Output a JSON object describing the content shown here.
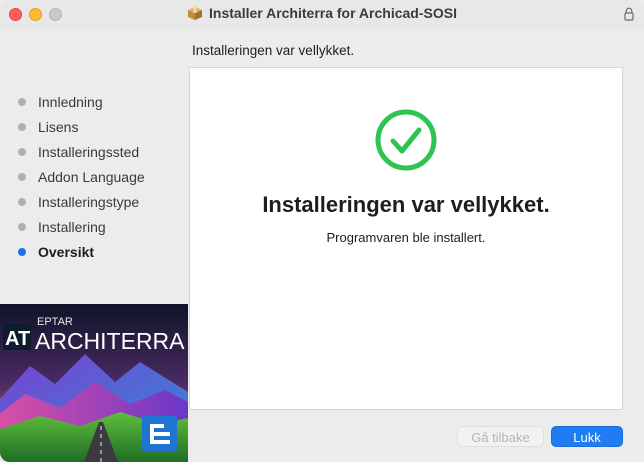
{
  "window": {
    "title": "Installer Architerra for Archicad-SOSI"
  },
  "header": {
    "subtitle": "Installeringen var vellykket."
  },
  "sidebar": {
    "steps": [
      {
        "label": "Innledning",
        "active": false
      },
      {
        "label": "Lisens",
        "active": false
      },
      {
        "label": "Installeringssted",
        "active": false
      },
      {
        "label": "Addon Language",
        "active": false
      },
      {
        "label": "Installeringstype",
        "active": false
      },
      {
        "label": "Installering",
        "active": false
      },
      {
        "label": "Oversikt",
        "active": true
      }
    ],
    "banner": {
      "brand_small": "EPTAR",
      "brand_large": "ARCHITERRA",
      "logo_letters": "AT"
    }
  },
  "main": {
    "heading": "Installeringen var vellykket.",
    "message": "Programvaren ble installert."
  },
  "buttons": {
    "back_label": "Gå tilbake",
    "close_label": "Lukk"
  },
  "colors": {
    "accent": "#1f7cf2",
    "success": "#2fc44f",
    "active_dot": "#1a73e8"
  }
}
